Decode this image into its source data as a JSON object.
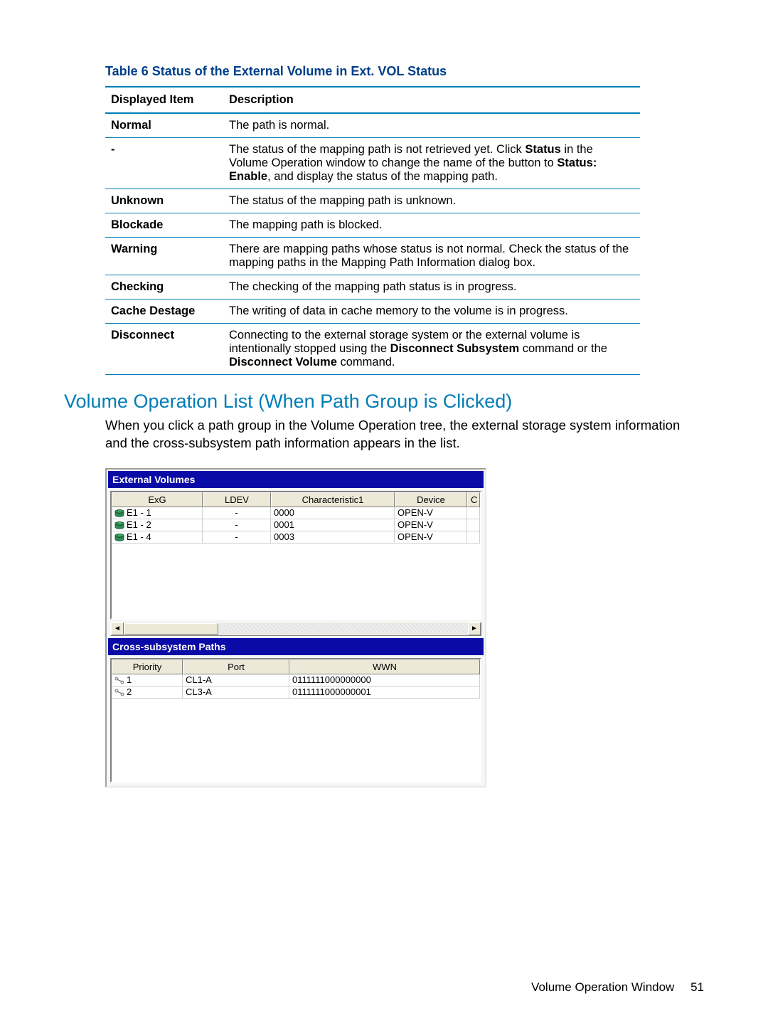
{
  "tableCaption": "Table 6 Status of the External Volume in Ext. VOL Status",
  "statusTable": {
    "headers": {
      "item": "Displayed Item",
      "desc": "Description"
    },
    "rows": [
      {
        "item": "Normal",
        "desc_html": "The path is normal."
      },
      {
        "item": "-",
        "desc_html": "The status of the mapping path is not retrieved yet. Click <b>Status</b> in the Volume Operation window to change the name of the button to <b>Status: Enable</b>, and display the status of the mapping path."
      },
      {
        "item": "Unknown",
        "desc_html": "The status of the mapping path is unknown."
      },
      {
        "item": "Blockade",
        "desc_html": "The mapping path is blocked."
      },
      {
        "item": "Warning",
        "desc_html": "There are mapping paths whose status is not normal. Check the status of the mapping paths in the Mapping Path Information dialog box."
      },
      {
        "item": "Checking",
        "desc_html": "The checking of the mapping path status is in progress."
      },
      {
        "item": "Cache Destage",
        "desc_html": "The writing of data in cache memory to the volume is in progress."
      },
      {
        "item": "Disconnect",
        "desc_html": "Connecting to the external storage system or the external volume is intentionally stopped using the <b>Disconnect Subsystem</b> command or the <b>Disconnect Volume</b> command."
      }
    ]
  },
  "sectionHeading": "Volume Operation List (When Path Group is Clicked)",
  "sectionBody": "When you click a path group in the Volume Operation tree, the external storage system information and the cross-subsystem path information appears in the list.",
  "screenshot": {
    "externalVolumes": {
      "title": "External Volumes",
      "headers": {
        "exg": "ExG",
        "ldev": "LDEV",
        "char1": "Characteristic1",
        "device": "Device",
        "extra": "C"
      },
      "rows": [
        {
          "exg": "E1 - 1",
          "ldev": "-",
          "char1": "0000",
          "device": "OPEN-V"
        },
        {
          "exg": "E1 - 2",
          "ldev": "-",
          "char1": "0001",
          "device": "OPEN-V"
        },
        {
          "exg": "E1 - 4",
          "ldev": "-",
          "char1": "0003",
          "device": "OPEN-V"
        }
      ]
    },
    "crossPaths": {
      "title": "Cross-subsystem Paths",
      "headers": {
        "priority": "Priority",
        "port": "Port",
        "wwn": "WWN"
      },
      "rows": [
        {
          "priority": "1",
          "port": "CL1-A",
          "wwn": "0111111000000000"
        },
        {
          "priority": "2",
          "port": "CL3-A",
          "wwn": "0111111000000001"
        }
      ]
    }
  },
  "footer": {
    "label": "Volume Operation Window",
    "page": "51"
  }
}
